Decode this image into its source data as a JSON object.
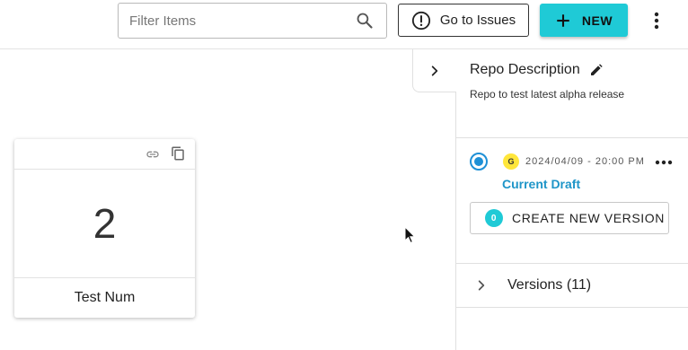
{
  "toolbar": {
    "filter_placeholder": "Filter Items",
    "issues_label": "Go to Issues",
    "new_label": "NEW"
  },
  "card": {
    "value": "2",
    "label": "Test Num"
  },
  "panel": {
    "title": "Repo Description",
    "description": "Repo to test latest alpha release",
    "version": {
      "badge": "G",
      "timestamp": "2024/04/09 - 20:00 PM",
      "draft_label": "Current Draft"
    },
    "create_badge": "0",
    "create_label": "CREATE NEW VERSION",
    "versions_label": "Versions (11)"
  },
  "colors": {
    "accent": "#1fcad6",
    "radio": "#1e90d6",
    "draft_link": "#1e95c8",
    "g_badge": "#ffe63b"
  },
  "icons": [
    "search-icon",
    "alert-circle-icon",
    "plus-icon",
    "more-vertical-icon",
    "link-icon",
    "copy-icon",
    "chevron-right-icon",
    "edit-icon",
    "more-horizontal-icon",
    "cursor-icon"
  ]
}
